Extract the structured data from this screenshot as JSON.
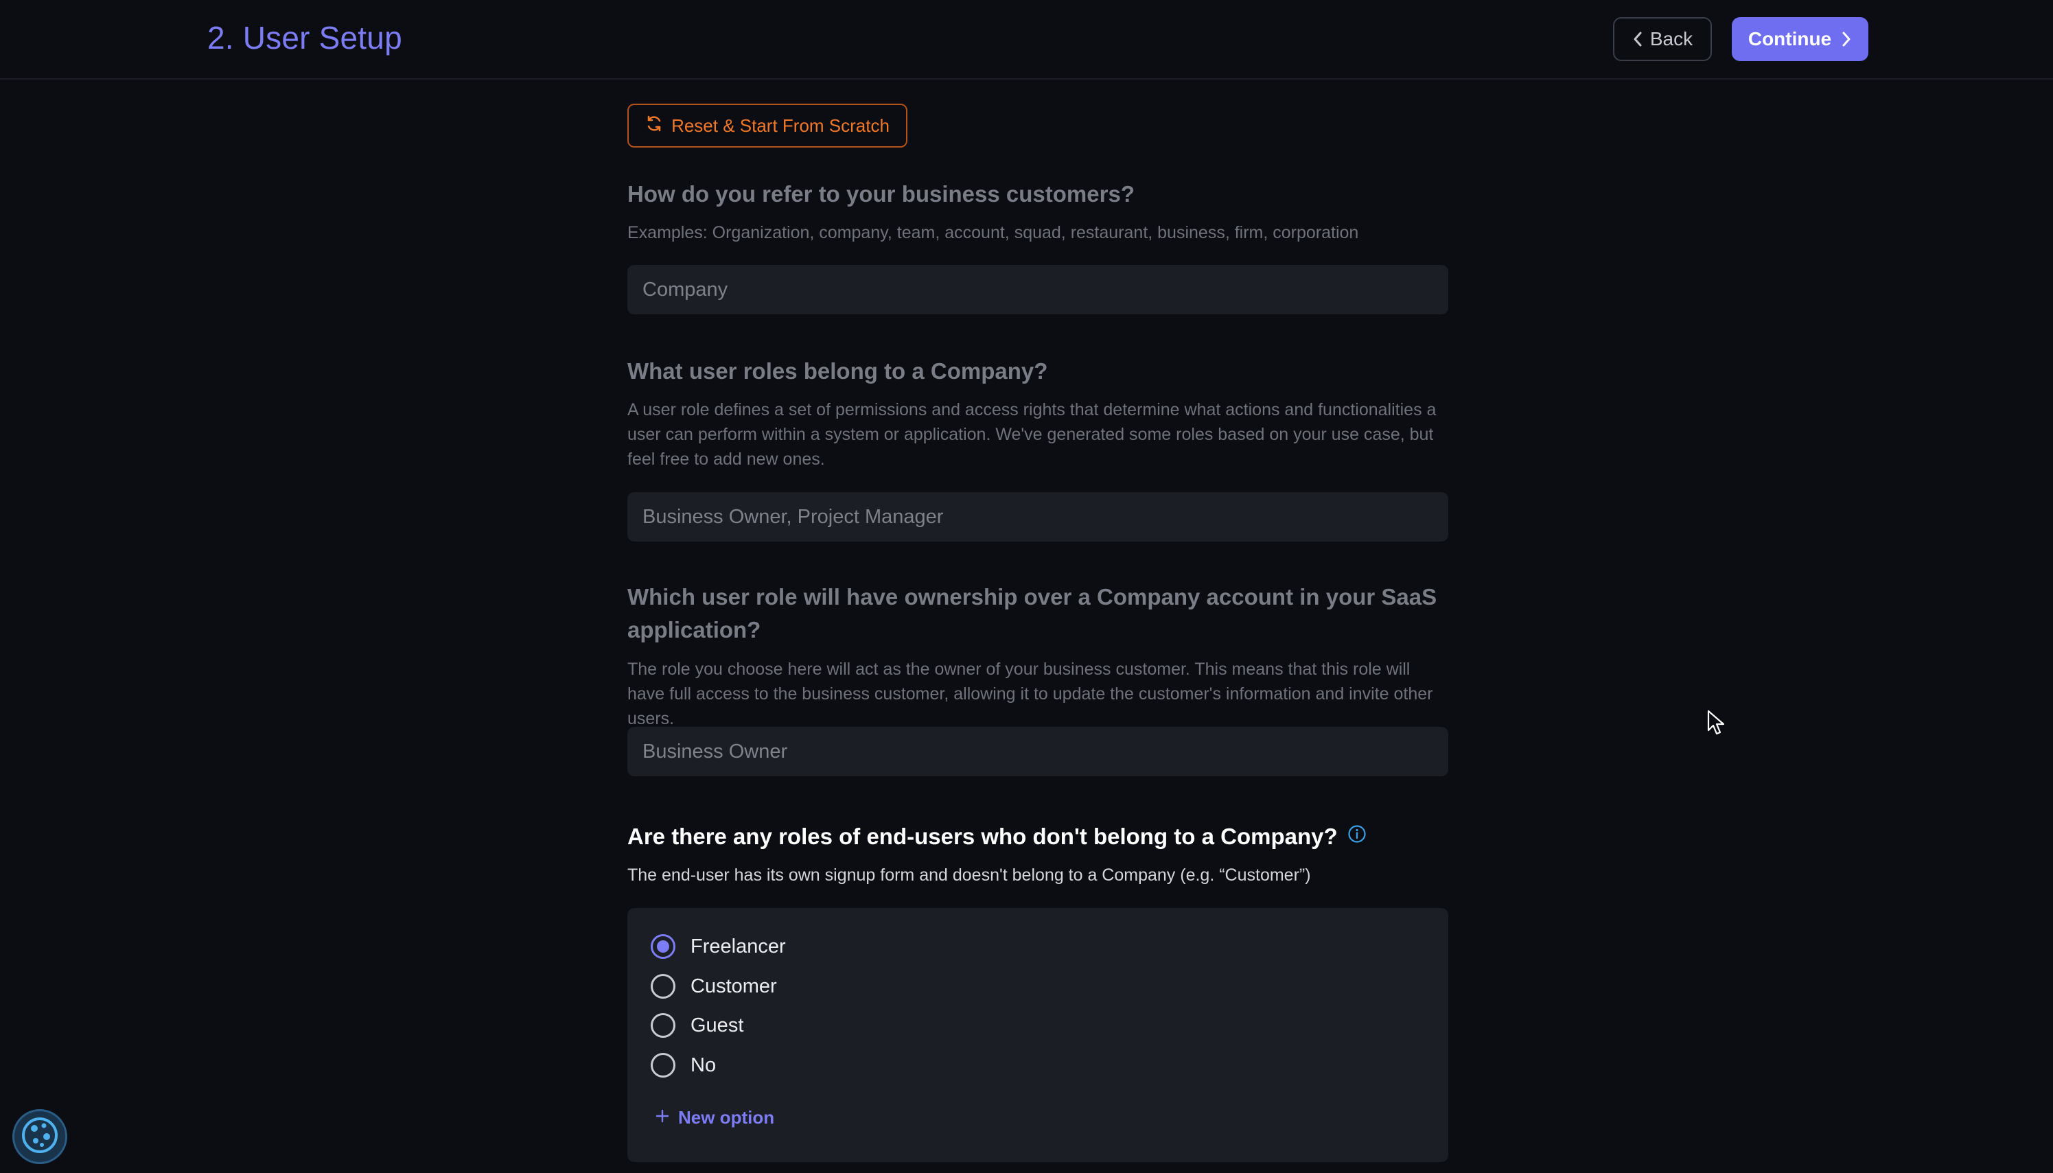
{
  "header": {
    "title": "2. User Setup",
    "back_label": "Back",
    "continue_label": "Continue"
  },
  "reset_button": {
    "label": "Reset & Start From Scratch"
  },
  "questions": [
    {
      "title": "How do you refer to your business customers?",
      "description": "Examples: Organization, company, team, account, squad, restaurant, business, firm, corporation",
      "value": "Company"
    },
    {
      "title": "What user roles belong to a Company?",
      "description": "A user role defines a set of permissions and access rights that determine what actions and functionalities a user can perform within a system or application. We've generated some roles based on your use case, but feel free to add new ones.",
      "value": "Business Owner, Project Manager"
    },
    {
      "title": "Which user role will have ownership over a Company account in your SaaS application?",
      "description": "The role you choose here will act as the owner of your business customer. This means that this role will have full access to the business customer, allowing it to update the customer's information and invite other users.",
      "value": "Business Owner"
    },
    {
      "title": "Are there any roles of end-users who don't belong to a Company?",
      "description": "The end-user has its own signup form and doesn't belong to a Company (e.g. “Customer”)",
      "options": [
        {
          "label": "Freelancer",
          "selected": true
        },
        {
          "label": "Customer",
          "selected": false
        },
        {
          "label": "Guest",
          "selected": false
        },
        {
          "label": "No",
          "selected": false
        }
      ],
      "new_option_label": "New option"
    }
  ],
  "icons": {
    "back": "chevron-left-icon",
    "continue": "chevron-right-icon",
    "reset": "refresh-icon",
    "info": "info-icon",
    "add": "plus-icon",
    "cursor": "mouse-cursor-icon",
    "fab": "cookie-icon"
  },
  "colors": {
    "accent": "#7c7cf4",
    "reset": "#f0782a",
    "background": "#0b0d12",
    "field": "#1c1e26",
    "info": "#3aa0e6"
  }
}
